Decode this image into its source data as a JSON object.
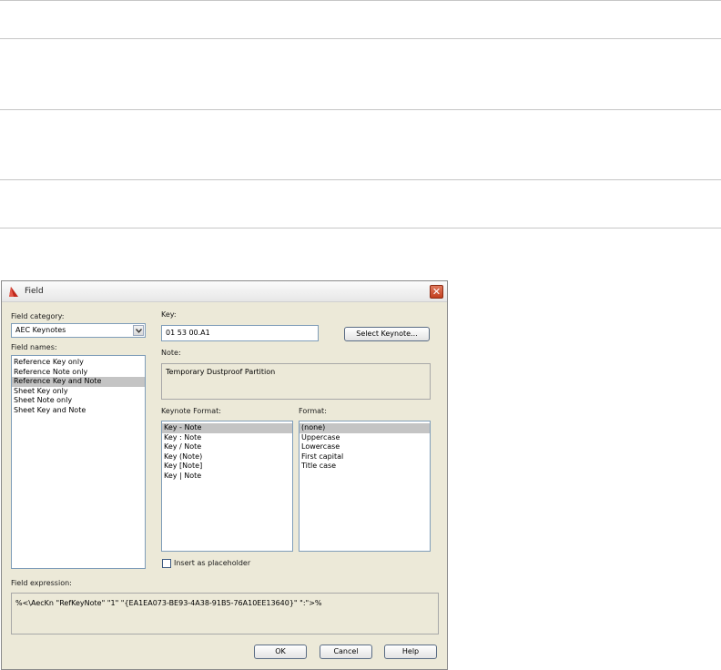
{
  "window": {
    "title": "Field",
    "close_glyph": "✕"
  },
  "field_category": {
    "label": "Field category:",
    "value": "AEC Keynotes"
  },
  "field_names": {
    "label": "Field names:",
    "items": [
      "Reference Key only",
      "Reference Note only",
      "Reference Key and Note",
      "Sheet Key only",
      "Sheet Note only",
      "Sheet Key and Note"
    ],
    "selected_index": 2
  },
  "key": {
    "label": "Key:",
    "value": "01 53 00.A1",
    "select_button": "Select Keynote..."
  },
  "note": {
    "label": "Note:",
    "value": "Temporary Dustproof Partition"
  },
  "keynote_format": {
    "label": "Keynote Format:",
    "items": [
      "Key - Note",
      "Key : Note",
      "Key / Note",
      "Key (Note)",
      "Key [Note]",
      "Key | Note"
    ],
    "selected_index": 0
  },
  "format": {
    "label": "Format:",
    "items": [
      "(none)",
      "Uppercase",
      "Lowercase",
      "First capital",
      "Title case"
    ],
    "selected_index": 0
  },
  "placeholder": {
    "label": "Insert as placeholder",
    "checked": false
  },
  "field_expression": {
    "label": "Field expression:",
    "value": "%<\\AecKn \"RefKeyNote\" \"1\" \"{EA1EA073-BE93-4A38-91B5-76A10EE13640}\" \":\">%"
  },
  "buttons": {
    "ok": "OK",
    "cancel": "Cancel",
    "help": "Help"
  },
  "colors": {
    "selection": "#c4c4c4",
    "dialog_bg": "#ece9d8",
    "close": "#c2401f"
  }
}
